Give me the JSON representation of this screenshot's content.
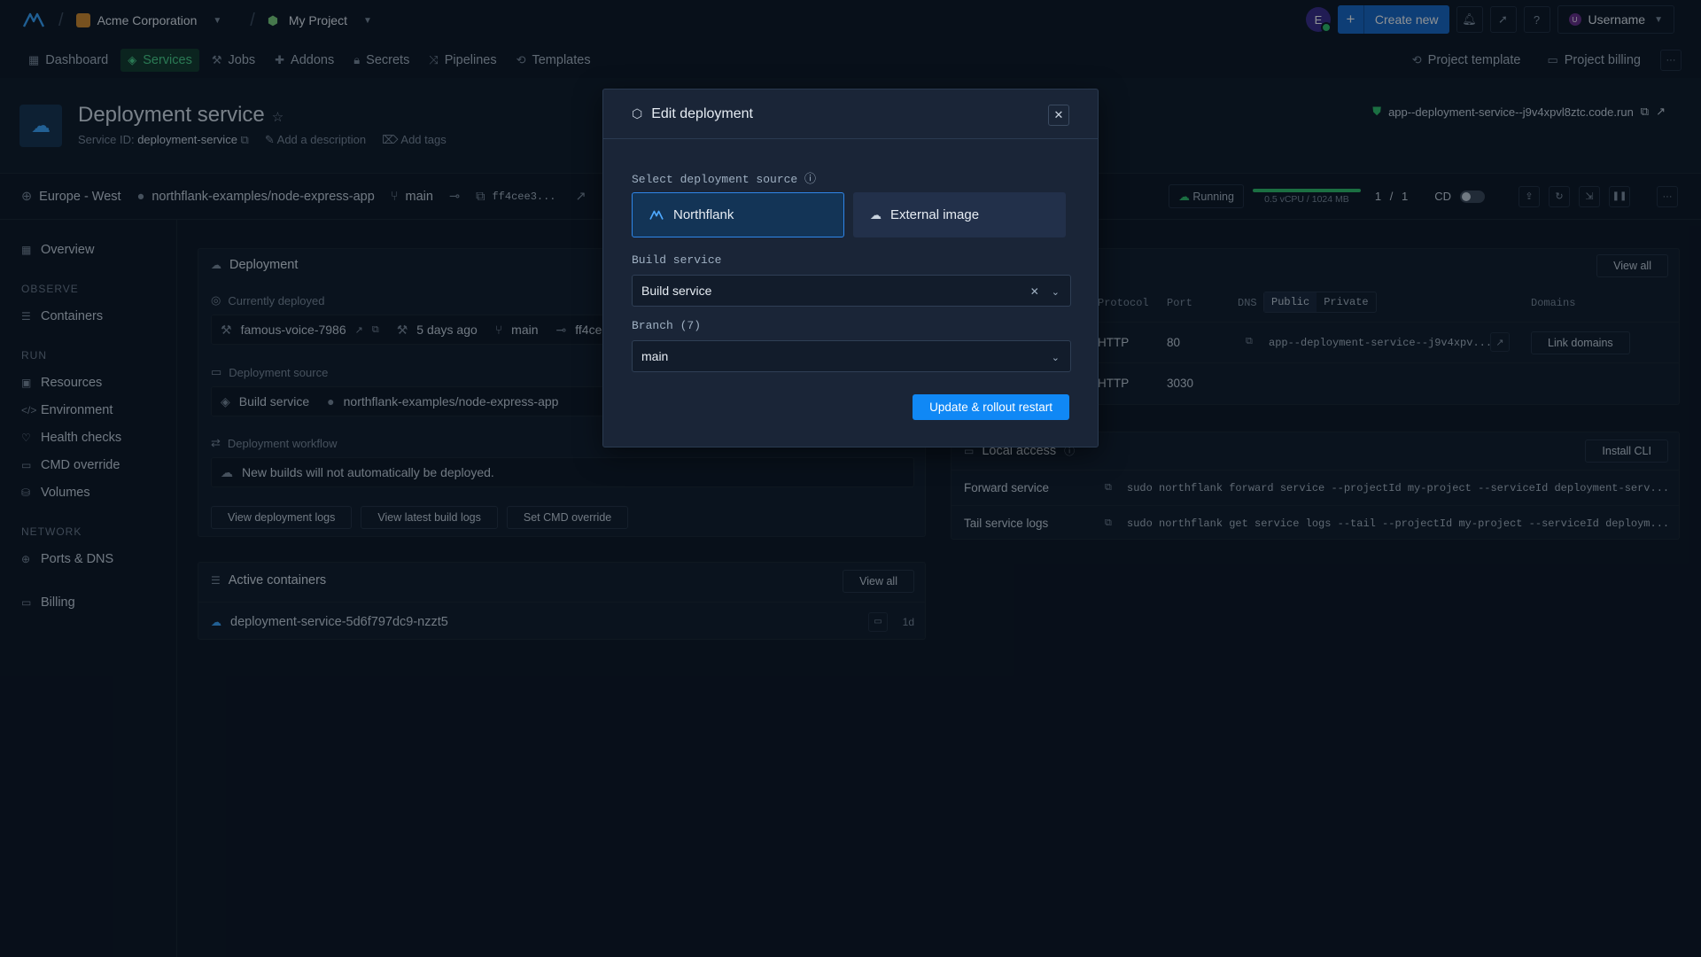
{
  "topbar": {
    "org": "Acme Corporation",
    "project": "My Project",
    "avatar_initial": "E",
    "create_label": "Create new",
    "username": "Username"
  },
  "nav": {
    "items": [
      {
        "label": "Dashboard",
        "icon": "grid-icon"
      },
      {
        "label": "Services",
        "icon": "layers-icon"
      },
      {
        "label": "Jobs",
        "icon": "jobs-icon"
      },
      {
        "label": "Addons",
        "icon": "puzzle-icon"
      },
      {
        "label": "Secrets",
        "icon": "lock-icon"
      },
      {
        "label": "Pipelines",
        "icon": "pipelines-icon"
      },
      {
        "label": "Templates",
        "icon": "templates-icon"
      }
    ],
    "active": "Services",
    "project_template": "Project template",
    "project_billing": "Project billing"
  },
  "service": {
    "title": "Deployment service",
    "id_label": "Service ID:",
    "id_value": "deployment-service",
    "add_description": "Add a description",
    "add_tags": "Add tags",
    "dns": "app--deployment-service--j9v4xpvl8ztc.code.run"
  },
  "status": {
    "region": "Europe - West",
    "repo": "northflank-examples/node-express-app",
    "branch": "main",
    "commit": "ff4cee3...",
    "state": "Running",
    "resources": "0.5 vCPU / 1024 MB",
    "usage_fraction": 1.0,
    "instances": "1 / 1",
    "cd_label": "CD"
  },
  "sidebar": {
    "top": [
      {
        "label": "Overview"
      }
    ],
    "observe_title": "OBSERVE",
    "observe": [
      {
        "label": "Containers"
      }
    ],
    "run_title": "RUN",
    "run": [
      {
        "label": "Resources"
      },
      {
        "label": "Environment"
      },
      {
        "label": "Health checks"
      },
      {
        "label": "CMD override"
      },
      {
        "label": "Volumes"
      }
    ],
    "network_title": "NETWORK",
    "network": [
      {
        "label": "Ports & DNS"
      }
    ],
    "billing": "Billing"
  },
  "deployment_card": {
    "title": "Deployment",
    "currently_deployed": "Currently deployed",
    "build_name": "famous-voice-7986",
    "age": "5 days ago",
    "branch": "main",
    "commit": "ff4ce",
    "source_label": "Deployment source",
    "source_type": "Build service",
    "source_repo": "northflank-examples/node-express-app",
    "workflow_label": "Deployment workflow",
    "workflow_text": "New builds will not automatically be deployed.",
    "btn_logs": "View deployment logs",
    "btn_build_logs": "View latest build logs",
    "btn_cmd": "Set CMD override"
  },
  "containers_card": {
    "title": "Active containers",
    "view_all": "View all",
    "container": "deployment-service-5d6f797dc9-nzzt5",
    "age": "1d"
  },
  "ports_card": {
    "view_all": "View all",
    "headers": [
      "Protocol",
      "Port",
      "DNS",
      "Domains"
    ],
    "dns_public": "Public",
    "dns_private": "Private",
    "rows": [
      {
        "protocol": "HTTP",
        "port": "80",
        "dns": "app--deployment-service--j9v4xpv...",
        "action": "Link domains"
      },
      {
        "protocol": "HTTP",
        "port": "3030"
      }
    ]
  },
  "local_access": {
    "title": "Local access",
    "install_cli": "Install CLI",
    "rows": [
      {
        "label": "Forward service",
        "cmd": "sudo northflank forward service --projectId my-project --serviceId deployment-serv..."
      },
      {
        "label": "Tail service logs",
        "cmd": "sudo northflank get service logs --tail --projectId my-project --serviceId deploym..."
      }
    ]
  },
  "modal": {
    "title": "Edit deployment",
    "source_label": "Select deployment source",
    "options": [
      {
        "label": "Northflank",
        "selected": true
      },
      {
        "label": "External image",
        "selected": false
      }
    ],
    "build_service_label": "Build service",
    "build_service_value": "Build service",
    "branch_label": "Branch (7)",
    "branch_value": "main",
    "submit": "Update & rollout restart"
  },
  "colors": {
    "background": "#0b1421",
    "accent_blue": "#1088f5",
    "active_green": "#49d48a",
    "modal_bg": "#1a2537"
  }
}
